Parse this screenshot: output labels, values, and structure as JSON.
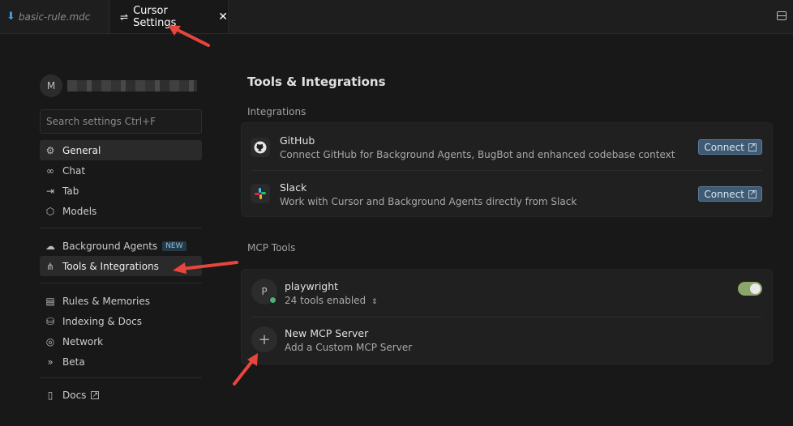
{
  "tabs": [
    {
      "label": "basic-rule.mdc",
      "icon": "download-arrow-icon"
    },
    {
      "label": "Cursor Settings",
      "icon": "settings-sliders-icon",
      "close": "✕"
    }
  ],
  "profile": {
    "initial": "M"
  },
  "search": {
    "placeholder": "Search settings Ctrl+F"
  },
  "sidebar": {
    "group1": [
      {
        "label": "General",
        "icon": "gear-icon"
      },
      {
        "label": "Chat",
        "icon": "infinity-icon"
      },
      {
        "label": "Tab",
        "icon": "arrow-right-bar-icon"
      },
      {
        "label": "Models",
        "icon": "cube-icon"
      }
    ],
    "group2": [
      {
        "label": "Background Agents",
        "icon": "cloud-icon",
        "badge": "NEW"
      },
      {
        "label": "Tools & Integrations",
        "icon": "network-icon",
        "active": true
      }
    ],
    "group3": [
      {
        "label": "Rules & Memories",
        "icon": "document-icon"
      },
      {
        "label": "Indexing & Docs",
        "icon": "database-icon"
      },
      {
        "label": "Network",
        "icon": "globe-icon"
      },
      {
        "label": "Beta",
        "icon": "double-chevron-icon"
      }
    ],
    "group4": [
      {
        "label": "Docs",
        "icon": "book-icon"
      }
    ]
  },
  "main": {
    "title": "Tools & Integrations",
    "integrations_label": "Integrations",
    "integrations": [
      {
        "name": "GitHub",
        "desc": "Connect GitHub for Background Agents, BugBot and enhanced codebase context",
        "button": "Connect"
      },
      {
        "name": "Slack",
        "desc": "Work with Cursor and Background Agents directly from Slack",
        "button": "Connect"
      }
    ],
    "mcp_label": "MCP Tools",
    "mcp_servers": [
      {
        "initial": "P",
        "name": "playwright",
        "desc": "24 tools enabled",
        "enabled": true
      },
      {
        "name": "New MCP Server",
        "desc": "Add a Custom MCP Server"
      }
    ]
  },
  "colors": {
    "accent": "#3f5a72",
    "toggle_on": "#8aa66b",
    "annotation_arrow": "#e8453c"
  }
}
